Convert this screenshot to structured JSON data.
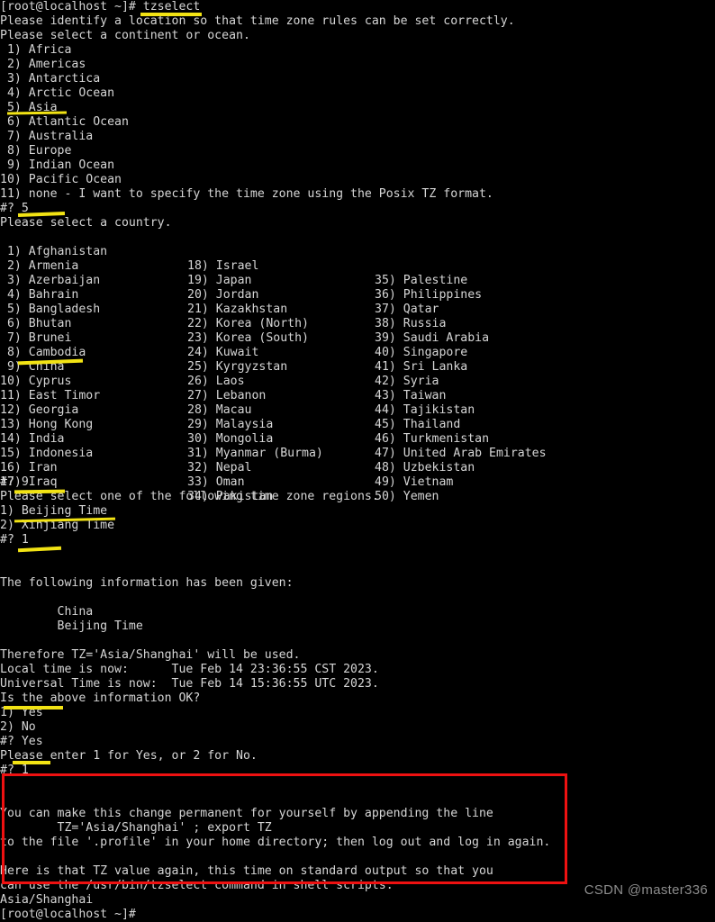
{
  "terminal": {
    "title": "tzselect terminal session",
    "background_color": "#000000",
    "text_color": "#d6d6d6",
    "highlight_color": "#f2e314",
    "annotation_box_color": "#ee1111",
    "prompt_top": "[root@localhost ~]# tzselect",
    "intro_1": "Please identify a location so that time zone rules can be set correctly.",
    "intro_2": "Please select a continent or ocean.",
    "continents": [
      " 1) Africa",
      " 2) Americas",
      " 3) Antarctica",
      " 4) Arctic Ocean",
      " 5) Asia",
      " 6) Atlantic Ocean",
      " 7) Australia",
      " 8) Europe",
      " 9) Indian Ocean",
      "10) Pacific Ocean",
      "11) none - I want to specify the time zone using the Posix TZ format."
    ],
    "answer_continent": "#? 5",
    "country_prompt": "Please select a country.",
    "countries_col1": [
      " 1) Afghanistan",
      " 2) Armenia",
      " 3) Azerbaijan",
      " 4) Bahrain",
      " 5) Bangladesh",
      " 6) Bhutan",
      " 7) Brunei",
      " 8) Cambodia",
      " 9) China",
      "10) Cyprus",
      "11) East Timor",
      "12) Georgia",
      "13) Hong Kong",
      "14) India",
      "15) Indonesia",
      "16) Iran",
      "17) Iraq"
    ],
    "countries_col2": [
      "18) Israel",
      "19) Japan",
      "20) Jordan",
      "21) Kazakhstan",
      "22) Korea (North)",
      "23) Korea (South)",
      "24) Kuwait",
      "25) Kyrgyzstan",
      "26) Laos",
      "27) Lebanon",
      "28) Macau",
      "29) Malaysia",
      "30) Mongolia",
      "31) Myanmar (Burma)",
      "32) Nepal",
      "33) Oman",
      "34) Pakistan"
    ],
    "countries_col3": [
      "35) Palestine",
      "36) Philippines",
      "37) Qatar",
      "38) Russia",
      "39) Saudi Arabia",
      "40) Singapore",
      "41) Sri Lanka",
      "42) Syria",
      "43) Taiwan",
      "44) Tajikistan",
      "45) Thailand",
      "46) Turkmenistan",
      "47) United Arab Emirates",
      "48) Uzbekistan",
      "49) Vietnam",
      "50) Yemen",
      ""
    ],
    "answer_country": "#? 9",
    "region_prompt": "Please select one of the following time zone regions.",
    "regions": [
      "1) Beijing Time",
      "2) Xinjiang Time"
    ],
    "answer_region": "#? 1",
    "given_header": "The following information has been given:",
    "given_country": "        China",
    "given_region": "        Beijing Time",
    "therefore": "Therefore TZ='Asia/Shanghai' will be used.",
    "local_time": "Local time is now:      Tue Feb 14 23:36:55 CST 2023.",
    "universal_time": "Universal Time is now:  Tue Feb 14 15:36:55 UTC 2023.",
    "confirm_prompt": "Is the above information OK?",
    "confirm_yes": "1) Yes",
    "confirm_no": "2) No",
    "answer_bad": "#? Yes",
    "reenter_hint": "Please enter 1 for Yes, or 2 for No.",
    "answer_confirm": "#? 1",
    "perm_1": "You can make this change permanent for yourself by appending the line",
    "perm_2": "        TZ='Asia/Shanghai' ; export TZ",
    "perm_3": "to the file '.profile' in your home directory; then log out and log in again.",
    "tz_again_1": "Here is that TZ value again, this time on standard output so that you",
    "tz_again_2": "can use the /usr/bin/tzselect command in shell scripts:",
    "tz_value": "Asia/Shanghai",
    "prompt_bottom": "[root@localhost ~]#"
  },
  "watermark": {
    "text": "CSDN @master336"
  }
}
